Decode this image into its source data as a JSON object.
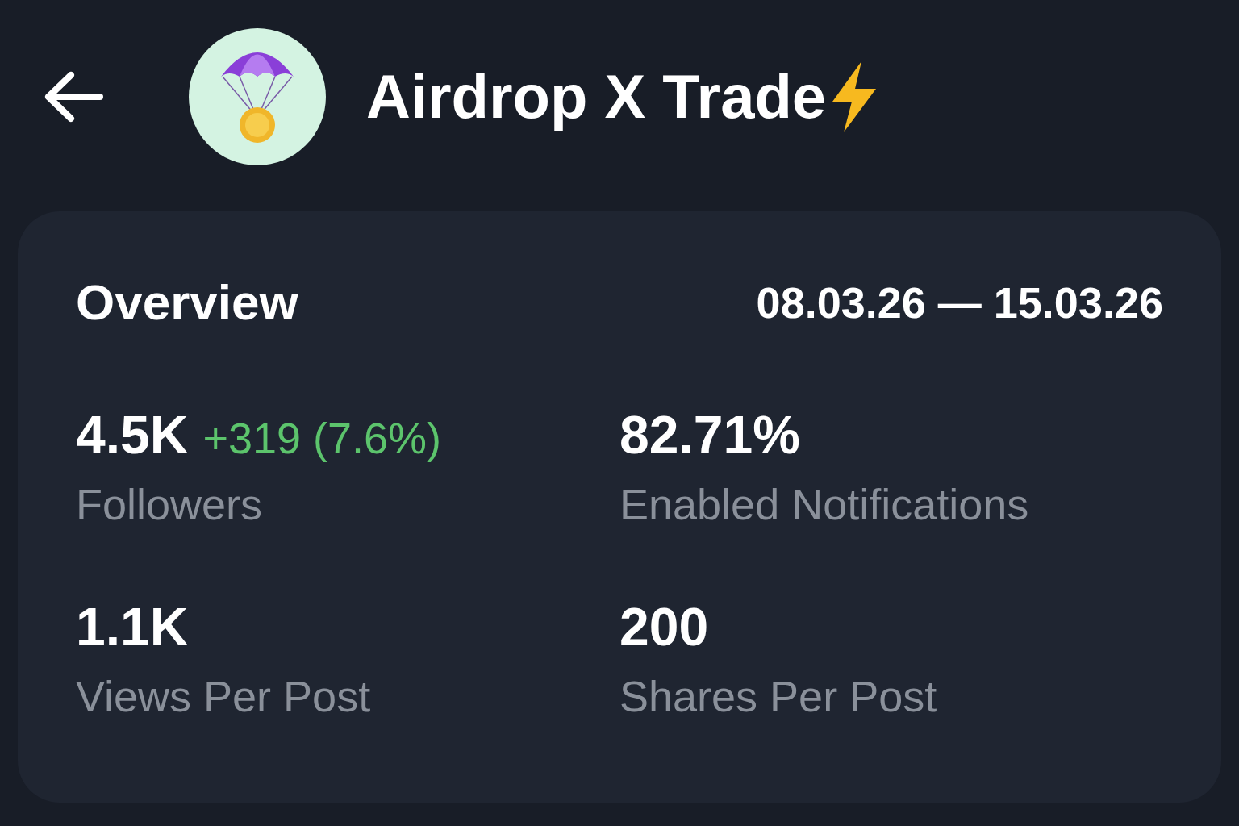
{
  "header": {
    "title": "Airdrop X Trade"
  },
  "overview": {
    "title": "Overview",
    "date_range": "08.03.26 — 15.03.26",
    "stats": [
      {
        "value": "4.5K",
        "change": "+319 (7.6%)",
        "label": "Followers"
      },
      {
        "value": "82.71%",
        "label": "Enabled Notifications"
      },
      {
        "value": "1.1K",
        "label": "Views Per Post"
      },
      {
        "value": "200",
        "label": "Shares Per Post"
      }
    ]
  }
}
